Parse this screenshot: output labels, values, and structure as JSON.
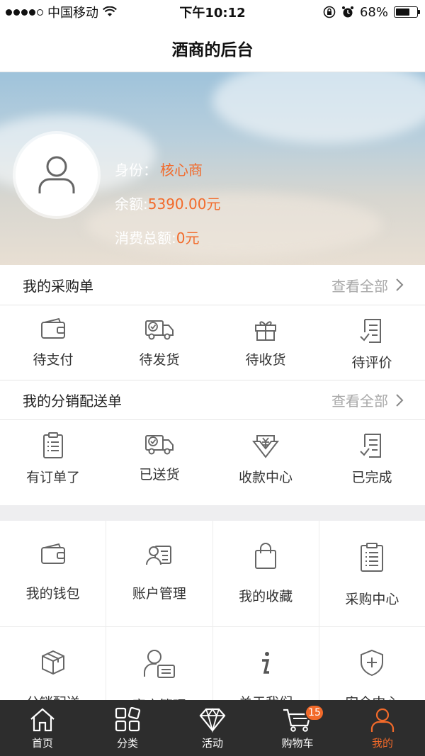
{
  "status_bar": {
    "carrier": "中国移动",
    "time": "下午10:12",
    "battery": "68%",
    "battery_level": 0.68
  },
  "nav": {
    "title": "酒商的后台"
  },
  "profile": {
    "identity_label": "身份：",
    "identity_value": "核心商",
    "balance_label": "余额:",
    "balance_value": "5390.00元",
    "total_label": "消费总额:",
    "total_value": "0元"
  },
  "purchase_orders": {
    "title": "我的采购单",
    "view_all": "查看全部",
    "items": [
      {
        "label": "待支付",
        "icon": "wallet-icon"
      },
      {
        "label": "待发货",
        "icon": "delivery-truck-icon"
      },
      {
        "label": "待收货",
        "icon": "gift-icon"
      },
      {
        "label": "待评价",
        "icon": "review-icon"
      }
    ]
  },
  "distribution_orders": {
    "title": "我的分销配送单",
    "view_all": "查看全部",
    "items": [
      {
        "label": "有订单了",
        "icon": "clipboard-icon"
      },
      {
        "label": "已送货",
        "icon": "delivery-truck-icon"
      },
      {
        "label": "收款中心",
        "icon": "yuan-receive-icon"
      },
      {
        "label": "已完成",
        "icon": "completed-icon"
      }
    ]
  },
  "grid": [
    {
      "label": "我的钱包",
      "icon": "wallet-icon"
    },
    {
      "label": "账户管理",
      "icon": "account-card-icon"
    },
    {
      "label": "我的收藏",
      "icon": "shopping-bag-icon"
    },
    {
      "label": "采购中心",
      "icon": "clipboard-icon"
    },
    {
      "label": "分销配送",
      "icon": "package-box-icon"
    },
    {
      "label": "客户管理",
      "icon": "customer-icon"
    },
    {
      "label": "关于我们",
      "icon": "info-icon"
    },
    {
      "label": "安全中心",
      "icon": "shield-plus-icon"
    }
  ],
  "tab_bar": {
    "tabs": [
      {
        "label": "首页",
        "icon": "home-icon"
      },
      {
        "label": "分类",
        "icon": "category-grid-icon"
      },
      {
        "label": "活动",
        "icon": "diamond-icon"
      },
      {
        "label": "购物车",
        "icon": "cart-icon",
        "badge": "15"
      },
      {
        "label": "我的",
        "icon": "user-icon",
        "active": true
      }
    ]
  },
  "colors": {
    "accent": "#f26a2a",
    "tab_bg": "#2d2d2d",
    "icon_gray": "#666666"
  }
}
